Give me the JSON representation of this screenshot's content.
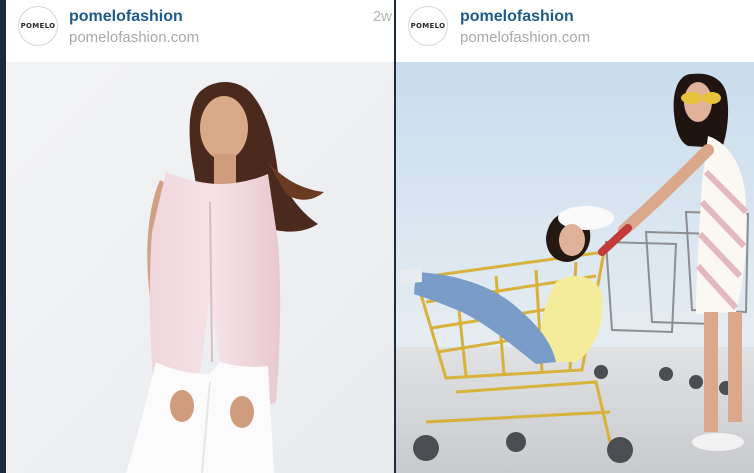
{
  "posts": [
    {
      "username": "pomelofashion",
      "location": "pomelofashion.com",
      "time": "2w",
      "avatar_text": "POMELO",
      "photo": "model-pink-sleeveless-top"
    },
    {
      "username": "pomelofashion",
      "location": "pomelofashion.com",
      "time": "",
      "avatar_text": "POMELO",
      "photo": "models-shopping-cart"
    }
  ],
  "colors": {
    "background": "#1b2a3f",
    "username": "#1f5b8a",
    "secondary_text": "#a9a9a9"
  }
}
